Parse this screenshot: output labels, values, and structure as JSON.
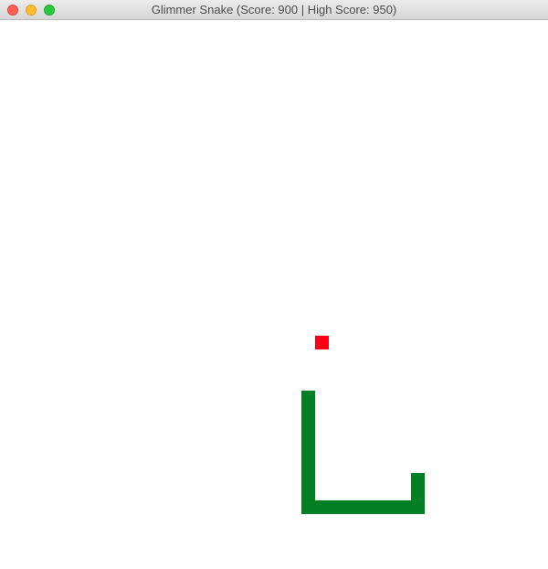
{
  "window": {
    "title": "Glimmer Snake (Score: 900 | High Score: 950)"
  },
  "game": {
    "grid_columns": 40,
    "grid_rows": 40,
    "score": 900,
    "high_score": 950,
    "colors": {
      "background": "#ffffff",
      "snake": "#027f23",
      "apple": "#fe0016"
    },
    "apple": {
      "col": 23,
      "row": 23
    },
    "snake": [
      {
        "col": 22,
        "row": 27
      },
      {
        "col": 22,
        "row": 28
      },
      {
        "col": 22,
        "row": 29
      },
      {
        "col": 22,
        "row": 30
      },
      {
        "col": 22,
        "row": 31
      },
      {
        "col": 22,
        "row": 32
      },
      {
        "col": 22,
        "row": 33
      },
      {
        "col": 22,
        "row": 34
      },
      {
        "col": 22,
        "row": 35
      },
      {
        "col": 23,
        "row": 35
      },
      {
        "col": 24,
        "row": 35
      },
      {
        "col": 25,
        "row": 35
      },
      {
        "col": 26,
        "row": 35
      },
      {
        "col": 27,
        "row": 35
      },
      {
        "col": 28,
        "row": 35
      },
      {
        "col": 29,
        "row": 35
      },
      {
        "col": 30,
        "row": 35
      },
      {
        "col": 30,
        "row": 34
      },
      {
        "col": 30,
        "row": 33
      }
    ]
  }
}
